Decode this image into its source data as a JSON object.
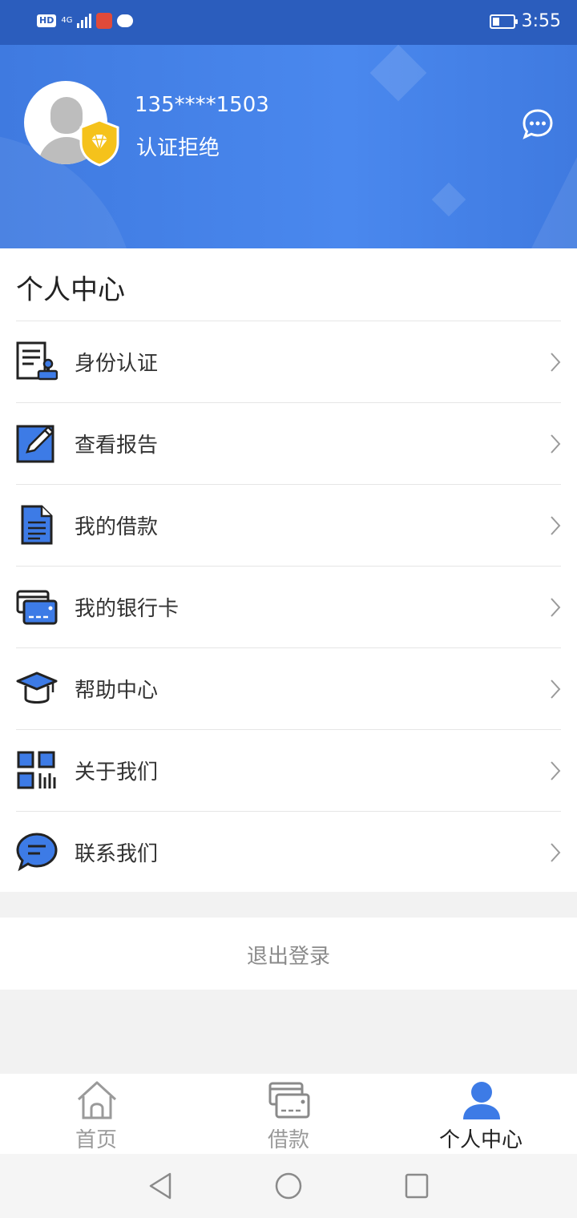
{
  "status_bar": {
    "left_indicators": [
      "HD",
      "4G"
    ],
    "time": "3:55",
    "battery_level": 0.35
  },
  "profile": {
    "phone": "135****1503",
    "auth_status": "认证拒绝"
  },
  "menu": {
    "title": "个人中心",
    "items": [
      {
        "label": "身份认证",
        "icon": "id-document-icon"
      },
      {
        "label": "查看报告",
        "icon": "edit-report-icon"
      },
      {
        "label": "我的借款",
        "icon": "document-list-icon"
      },
      {
        "label": "我的银行卡",
        "icon": "bank-card-icon"
      },
      {
        "label": "帮助中心",
        "icon": "graduation-cap-icon"
      },
      {
        "label": "关于我们",
        "icon": "qr-code-icon"
      },
      {
        "label": "联系我们",
        "icon": "chat-bubble-icon"
      }
    ]
  },
  "logout_label": "退出登录",
  "tabs": [
    {
      "label": "首页",
      "icon": "home-icon",
      "active": false
    },
    {
      "label": "借款",
      "icon": "wallet-card-icon",
      "active": false
    },
    {
      "label": "个人中心",
      "icon": "user-icon",
      "active": true
    }
  ],
  "colors": {
    "primary": "#3f7ae0",
    "icon_blue": "#3d7be6",
    "text_dark": "#222222",
    "muted": "#9a9a9a"
  }
}
